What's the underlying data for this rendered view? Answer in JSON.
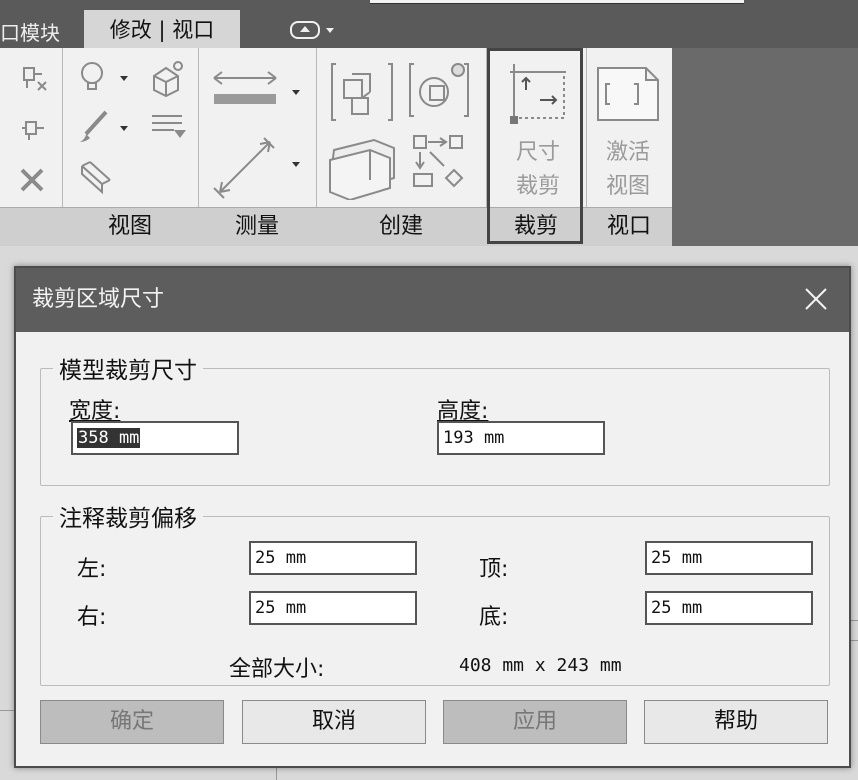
{
  "tabs": {
    "partial": "口模块",
    "active": "修改 | 视口"
  },
  "ribbon": {
    "panels": {
      "view": "视图",
      "measure": "测量",
      "create": "创建",
      "crop": "裁剪",
      "viewport": "视口"
    },
    "crop_size_button": [
      "尺寸",
      "裁剪"
    ],
    "activate_view_button": [
      "激活",
      "视图"
    ]
  },
  "dialog": {
    "title": "裁剪区域尺寸",
    "model_group": {
      "title": "模型裁剪尺寸",
      "width_label": "宽度:",
      "width_value": "358 mm",
      "height_label": "高度:",
      "height_value": "193 mm"
    },
    "offset_group": {
      "title": "注释裁剪偏移",
      "left_label": "左:",
      "left_value": "25 mm",
      "right_label": "右:",
      "right_value": "25 mm",
      "top_label": "顶:",
      "top_value": "25 mm",
      "bottom_label": "底:",
      "bottom_value": "25 mm",
      "total_label": "全部大小:",
      "total_value": "408 mm x 243 mm"
    },
    "buttons": {
      "ok": "确定",
      "cancel": "取消",
      "apply": "应用",
      "help": "帮助"
    }
  }
}
